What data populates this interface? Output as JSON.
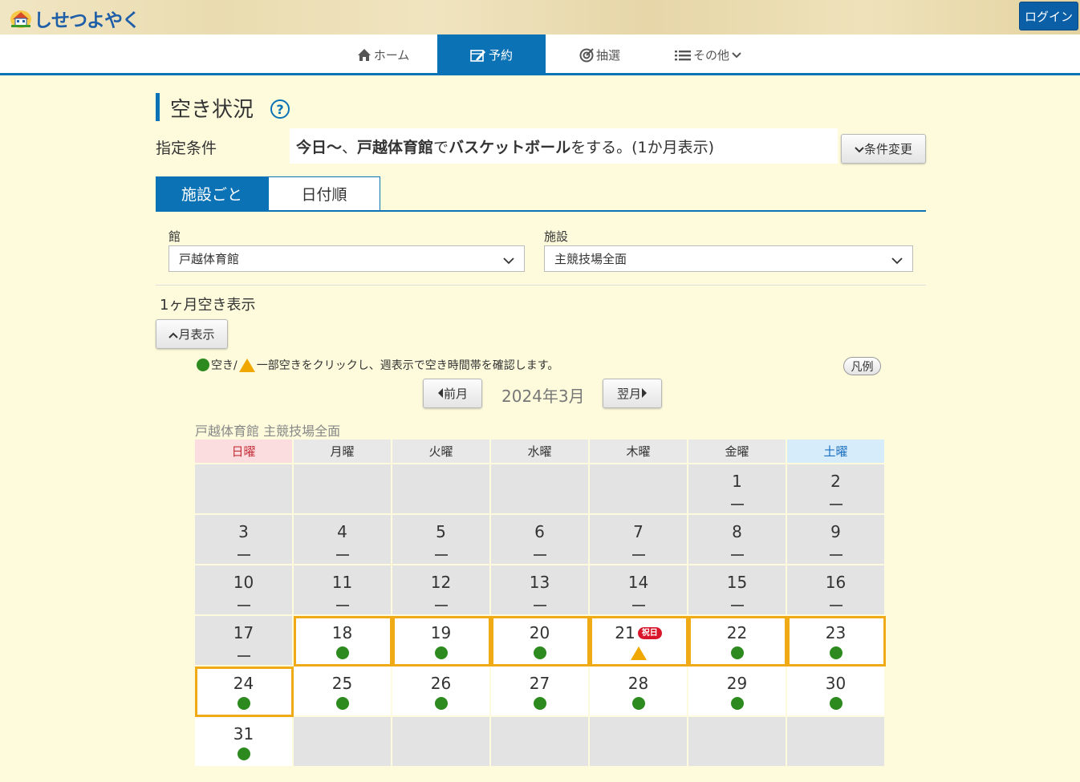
{
  "header": {
    "logo_text": "しせつよやく",
    "login_label": "ログイン"
  },
  "nav": {
    "home": "ホーム",
    "reserve": "予約",
    "lottery": "抽選",
    "other": "その他"
  },
  "page": {
    "title": "空き状況",
    "help_symbol": "?"
  },
  "condition": {
    "label": "指定条件",
    "today": "今日～",
    "sep1": "、",
    "venue": "戸越体育館",
    "de": "で",
    "sport": "バスケットボール",
    "rest": "をする。(1か月表示)",
    "change_label": "条件変更"
  },
  "tabs": {
    "by_facility": "施設ごと",
    "by_date": "日付順"
  },
  "selects": {
    "hall_label": "館",
    "hall_value": "戸越体育館",
    "facility_label": "施設",
    "facility_value": "主競技場全面"
  },
  "month_view": {
    "caption": "1ヶ月空き表示",
    "toggle_label": "月表示",
    "legend_text_1": "空き/",
    "legend_text_2": "一部空きをクリックし、週表示で空き時間帯を確認します。",
    "legend_button": "凡例",
    "prev_label": "前月",
    "next_label": "翌月",
    "month_title": "2024年3月",
    "facility_caption": "戸越体育館 主競技場全面"
  },
  "calendar": {
    "weekdays": [
      "日曜",
      "月曜",
      "火曜",
      "水曜",
      "木曜",
      "金曜",
      "土曜"
    ],
    "holiday_label": "祝日",
    "status_colors": {
      "available": "#2d8a1f",
      "partial": "#f0a800",
      "highlight": "#f0aa15"
    },
    "days": [
      {
        "day": "",
        "status": "blank"
      },
      {
        "day": "",
        "status": "blank"
      },
      {
        "day": "",
        "status": "blank"
      },
      {
        "day": "",
        "status": "blank"
      },
      {
        "day": "",
        "status": "blank"
      },
      {
        "day": "1",
        "status": "none"
      },
      {
        "day": "2",
        "status": "none"
      },
      {
        "day": "3",
        "status": "none"
      },
      {
        "day": "4",
        "status": "none"
      },
      {
        "day": "5",
        "status": "none"
      },
      {
        "day": "6",
        "status": "none"
      },
      {
        "day": "7",
        "status": "none"
      },
      {
        "day": "8",
        "status": "none"
      },
      {
        "day": "9",
        "status": "none"
      },
      {
        "day": "10",
        "status": "none"
      },
      {
        "day": "11",
        "status": "none"
      },
      {
        "day": "12",
        "status": "none"
      },
      {
        "day": "13",
        "status": "none"
      },
      {
        "day": "14",
        "status": "none"
      },
      {
        "day": "15",
        "status": "none"
      },
      {
        "day": "16",
        "status": "none"
      },
      {
        "day": "17",
        "status": "none"
      },
      {
        "day": "18",
        "status": "available",
        "highlight": true
      },
      {
        "day": "19",
        "status": "available",
        "highlight": true
      },
      {
        "day": "20",
        "status": "available",
        "highlight": true
      },
      {
        "day": "21",
        "status": "partial",
        "highlight": true,
        "holiday": true
      },
      {
        "day": "22",
        "status": "available",
        "highlight": true
      },
      {
        "day": "23",
        "status": "available",
        "highlight": true
      },
      {
        "day": "24",
        "status": "available",
        "highlight": true
      },
      {
        "day": "25",
        "status": "available"
      },
      {
        "day": "26",
        "status": "available"
      },
      {
        "day": "27",
        "status": "available"
      },
      {
        "day": "28",
        "status": "available"
      },
      {
        "day": "29",
        "status": "available"
      },
      {
        "day": "30",
        "status": "available"
      },
      {
        "day": "31",
        "status": "available"
      },
      {
        "day": "",
        "status": "blank"
      },
      {
        "day": "",
        "status": "blank"
      },
      {
        "day": "",
        "status": "blank"
      },
      {
        "day": "",
        "status": "blank"
      },
      {
        "day": "",
        "status": "blank"
      },
      {
        "day": "",
        "status": "blank"
      }
    ]
  }
}
